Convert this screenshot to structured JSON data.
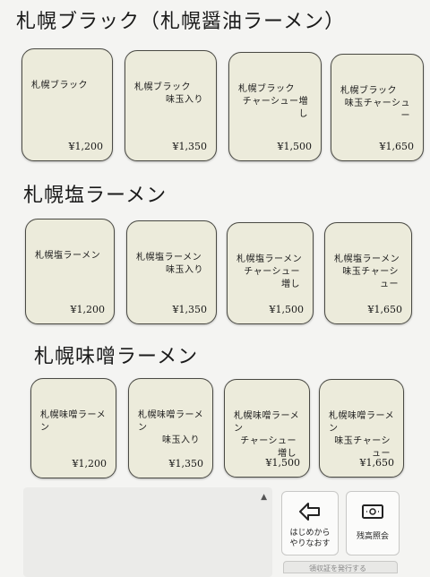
{
  "sections": [
    {
      "title": "札幌ブラック（札幌醤油ラーメン）",
      "items": [
        {
          "line1": "札幌ブラック",
          "line2": "",
          "price": "¥1,200"
        },
        {
          "line1": "札幌ブラック",
          "line2": "味玉入り",
          "price": "¥1,350"
        },
        {
          "line1": "札幌ブラック",
          "line2": "チャーシュー増し",
          "price": "¥1,500"
        },
        {
          "line1": "札幌ブラック",
          "line2": "味玉チャーシュー",
          "price": "¥1,650"
        }
      ]
    },
    {
      "title": "札幌塩ラーメン",
      "items": [
        {
          "line1": "札幌塩ラーメン",
          "line2": "",
          "price": "¥1,200"
        },
        {
          "line1": "札幌塩ラーメン",
          "line2": "味玉入り",
          "price": "¥1,350"
        },
        {
          "line1": "札幌塩ラーメン",
          "line2": "チャーシュー増し",
          "price": "¥1,500"
        },
        {
          "line1": "札幌塩ラーメン",
          "line2": "味玉チャーシュー",
          "price": "¥1,650"
        }
      ]
    },
    {
      "title": "札幌味噌ラーメン",
      "items": [
        {
          "line1": "札幌味噌ラーメン",
          "line2": "",
          "price": "¥1,200"
        },
        {
          "line1": "札幌味噌ラーメン",
          "line2": "味玉入り",
          "price": "¥1,350"
        },
        {
          "line1": "札幌味噌ラーメン",
          "line2": "チャーシュー増し",
          "price": "¥1,500"
        },
        {
          "line1": "札幌味噌ラーメン",
          "line2": "味玉チャーシュー",
          "price": "¥1,650"
        }
      ]
    }
  ],
  "controls": {
    "restart_line1": "はじめから",
    "restart_line2": "やりなおす",
    "restart_icon": "back-arrow-icon",
    "balance_label": "残高照会",
    "balance_icon": "banknote-icon",
    "scroll_up_glyph": "▲",
    "bottom_strip": "領収証を発行する"
  },
  "colors": {
    "tile_bg": "#ecebdb",
    "page_bg": "#f4f4f2"
  }
}
